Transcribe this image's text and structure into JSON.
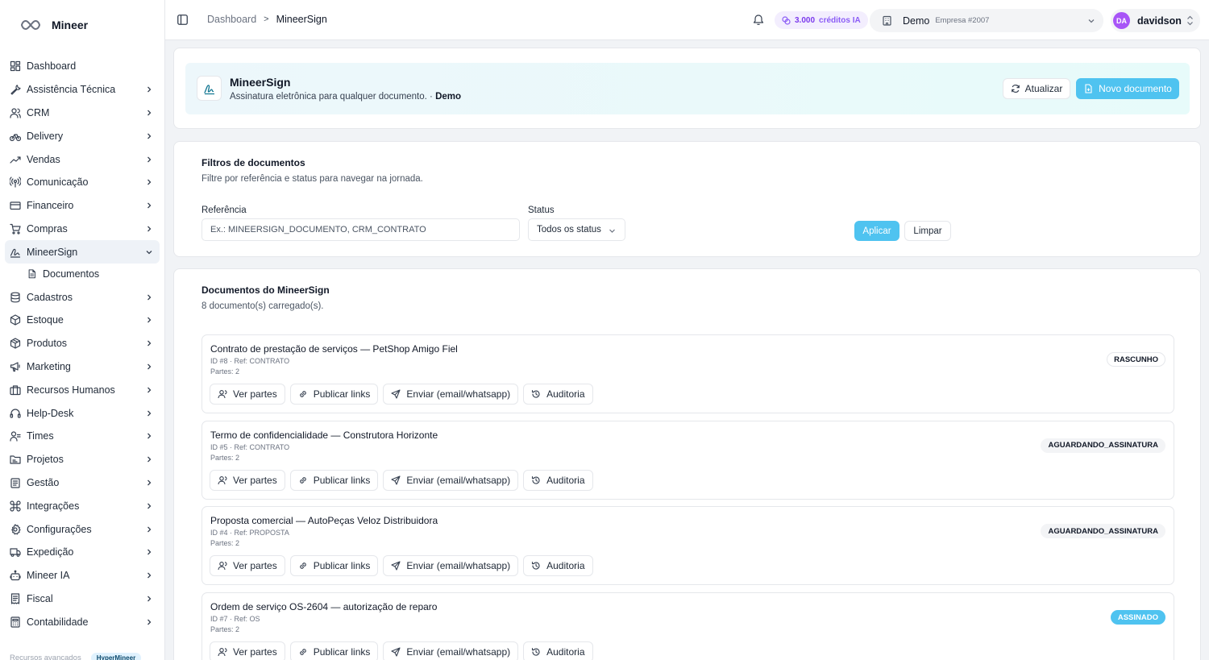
{
  "brand": {
    "name": "Mineer"
  },
  "sidebar": {
    "items": [
      {
        "label": "Dashboard",
        "icon": "dashboard-icon",
        "chevron": false
      },
      {
        "label": "Assistência Técnica",
        "icon": "wrench-icon",
        "chevron": true
      },
      {
        "label": "CRM",
        "icon": "users-icon",
        "chevron": true
      },
      {
        "label": "Delivery",
        "icon": "bike-icon",
        "chevron": true
      },
      {
        "label": "Vendas",
        "icon": "trend-icon",
        "chevron": true
      },
      {
        "label": "Comunicação",
        "icon": "radio-icon",
        "chevron": true
      },
      {
        "label": "Financeiro",
        "icon": "card-icon",
        "chevron": true
      },
      {
        "label": "Compras",
        "icon": "cart-icon",
        "chevron": true
      },
      {
        "label": "MineerSign",
        "icon": "signature-icon",
        "chevron": true,
        "expanded": true
      },
      {
        "label": "Cadastros",
        "icon": "database-icon",
        "chevron": true
      },
      {
        "label": "Estoque",
        "icon": "box-icon",
        "chevron": true
      },
      {
        "label": "Produtos",
        "icon": "package-icon",
        "chevron": true
      },
      {
        "label": "Marketing",
        "icon": "megaphone-icon",
        "chevron": true
      },
      {
        "label": "Recursos Humanos",
        "icon": "briefcase-icon",
        "chevron": true
      },
      {
        "label": "Help-Desk",
        "icon": "headset-icon",
        "chevron": true
      },
      {
        "label": "Times",
        "icon": "team-icon",
        "chevron": true
      },
      {
        "label": "Projetos",
        "icon": "folder-icon",
        "chevron": true
      },
      {
        "label": "Gestão",
        "icon": "clipboard-icon",
        "chevron": true
      },
      {
        "label": "Integrações",
        "icon": "command-icon",
        "chevron": true
      },
      {
        "label": "Configurações",
        "icon": "gear-icon",
        "chevron": true
      },
      {
        "label": "Expedição",
        "icon": "truck-icon",
        "chevron": true
      },
      {
        "label": "Mineer IA",
        "icon": "bot-icon",
        "chevron": true
      },
      {
        "label": "Fiscal",
        "icon": "receipt-icon",
        "chevron": true
      },
      {
        "label": "Contabilidade",
        "icon": "calculator-icon",
        "chevron": true
      }
    ],
    "sub_item": "Documentos",
    "footer_label": "Recursos avançados",
    "footer_badge": "HyperMineer"
  },
  "topbar": {
    "breadcrumb_root": "Dashboard",
    "breadcrumb_sep": ">",
    "breadcrumb_current": "MineerSign",
    "credits_amount": "3.000",
    "credits_suffix": "créditos IA",
    "company_name": "Demo",
    "company_sub": "Empresa #2007",
    "user_initials": "DA",
    "user_name": "davidson"
  },
  "hero": {
    "title": "MineerSign",
    "description": "Assinatura eletrônica para qualquer documento. · ",
    "company": "Demo",
    "refresh_label": "Atualizar",
    "new_label": "Novo documento"
  },
  "filters": {
    "title": "Filtros de documentos",
    "description": "Filtre por referência e status para navegar na jornada.",
    "ref_label": "Referência",
    "ref_placeholder": "Ex.: MINEERSIGN_DOCUMENTO, CRM_CONTRATO",
    "status_label": "Status",
    "status_value": "Todos os status",
    "apply_label": "Aplicar",
    "clear_label": "Limpar"
  },
  "documents": {
    "title": "Documentos do MineerSign",
    "count_text": "8 documento(s) carregado(s).",
    "action_labels": {
      "parties": "Ver partes",
      "publish": "Publicar links",
      "send": "Enviar (email/whatsapp)",
      "audit": "Auditoria"
    },
    "items": [
      {
        "title": "Contrato de prestação de serviços — PetShop Amigo Fiel",
        "meta": "ID #8 · Ref: CONTRATO",
        "parties": "Partes: 2",
        "status": "RASCUNHO",
        "status_kind": "draft"
      },
      {
        "title": "Termo de confidencialidade — Construtora Horizonte",
        "meta": "ID #5 · Ref: CONTRATO",
        "parties": "Partes: 2",
        "status": "AGUARDANDO_ASSINATURA",
        "status_kind": "waiting"
      },
      {
        "title": "Proposta comercial — AutoPeças Veloz Distribuidora",
        "meta": "ID #4 · Ref: PROPOSTA",
        "parties": "Partes: 2",
        "status": "AGUARDANDO_ASSINATURA",
        "status_kind": "waiting"
      },
      {
        "title": "Ordem de serviço OS-2604 — autorização de reparo",
        "meta": "ID #7 · Ref: OS",
        "parties": "Partes: 2",
        "status": "ASSINADO",
        "status_kind": "signed"
      }
    ]
  },
  "colors": {
    "primary": "#4fc3f0",
    "credits": "#7c3aed",
    "avatar": "#a855f7"
  }
}
